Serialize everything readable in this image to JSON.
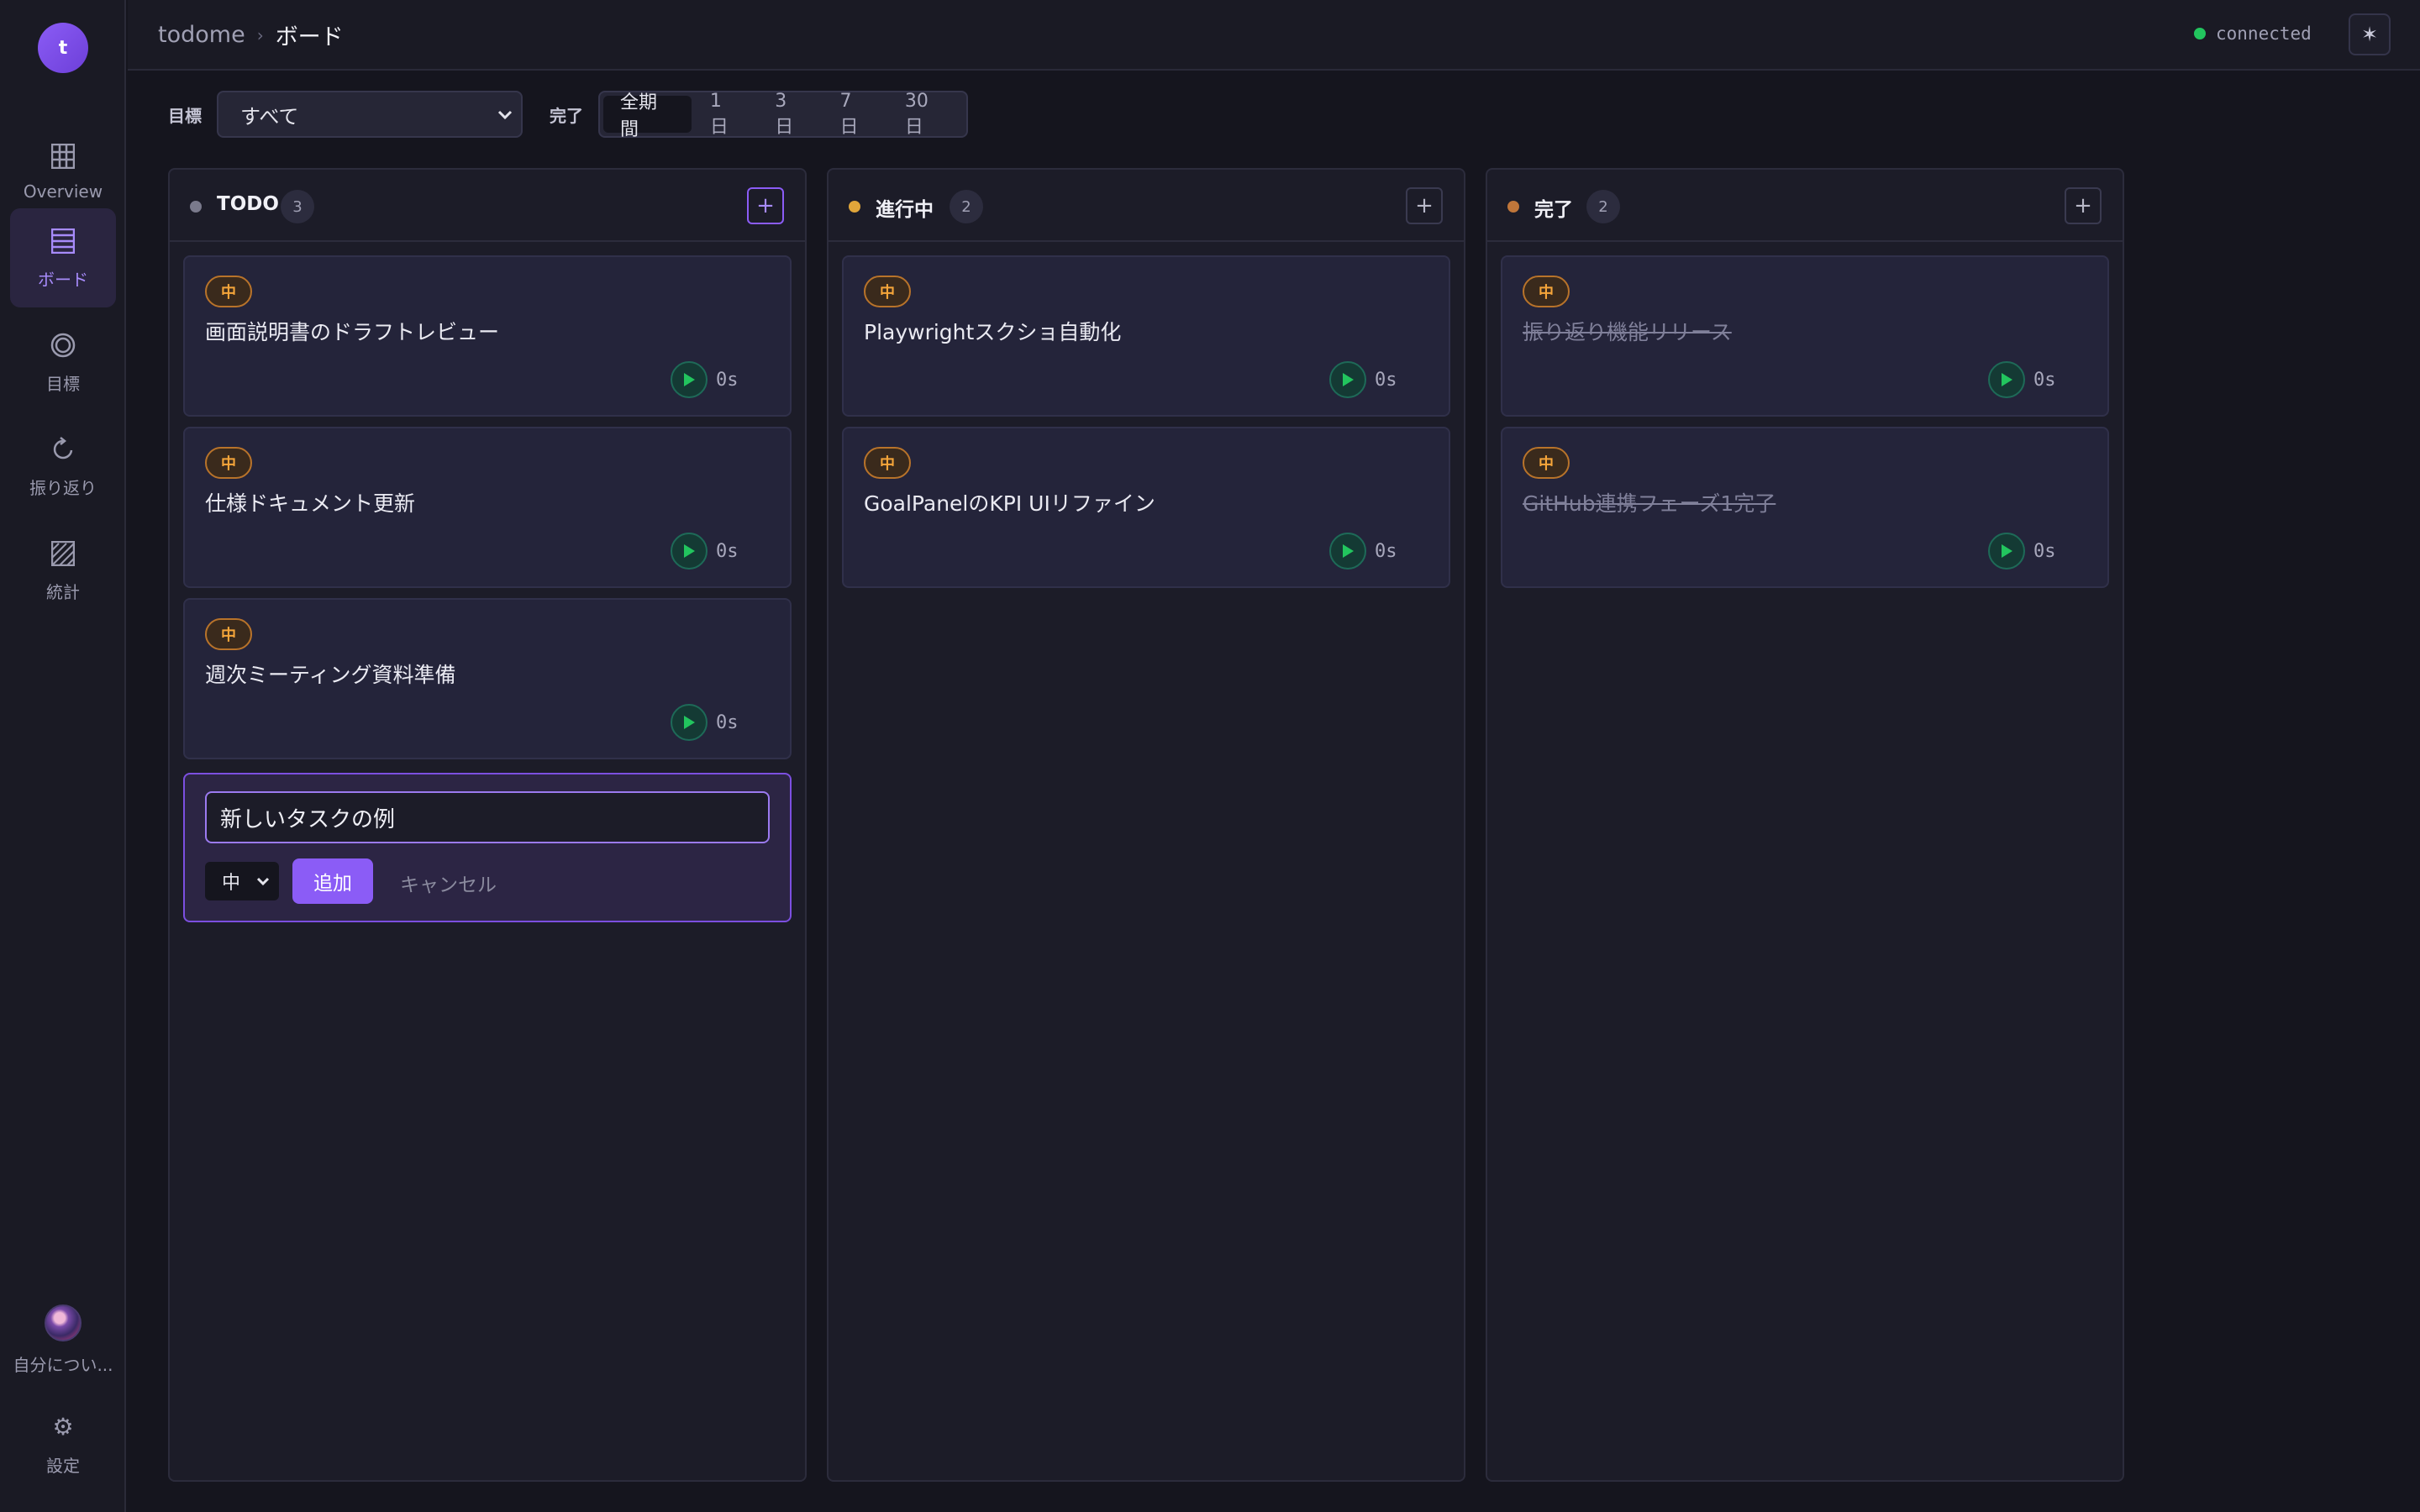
{
  "app": {
    "avatar_letter": "t",
    "accent": "#8b5cf6"
  },
  "header": {
    "breadcrumb_root": "todome",
    "breadcrumb_sep": "›",
    "breadcrumb_current": "ボード",
    "status_text": "connected",
    "status_color": "#22c55e",
    "theme_icon": "✶"
  },
  "sidebar": {
    "items": [
      {
        "label": "Overview",
        "icon": "grid-icon"
      },
      {
        "label": "ボード",
        "icon": "board-icon",
        "active": true
      },
      {
        "label": "目標",
        "icon": "target-icon"
      },
      {
        "label": "振り返り",
        "icon": "refresh-icon"
      },
      {
        "label": "統計",
        "icon": "stats-icon"
      }
    ],
    "profile_label": "自分につい...",
    "settings_label": "設定",
    "settings_icon": "⚙"
  },
  "filters": {
    "goal_label": "目標",
    "goal_value": "すべて",
    "done_label": "完了",
    "ranges": [
      "全期間",
      "1日",
      "3日",
      "7日",
      "30日"
    ],
    "active_range": "全期間"
  },
  "columns": [
    {
      "title": "TODO",
      "count": "3",
      "dot_color": "#7a7a8c",
      "cards": [
        {
          "priority": "中",
          "title": "画面説明書のドラフトレビュー",
          "time": "0s"
        },
        {
          "priority": "中",
          "title": "仕様ドキュメント更新",
          "time": "0s"
        },
        {
          "priority": "中",
          "title": "週次ミーティング資料準備",
          "time": "0s"
        }
      ]
    },
    {
      "title": "進行中",
      "count": "2",
      "dot_color": "#e0a53a",
      "cards": [
        {
          "priority": "中",
          "title": "Playwrightスクショ自動化",
          "time": "0s"
        },
        {
          "priority": "中",
          "title": "GoalPanelのKPI UIリファイン",
          "time": "0s"
        }
      ]
    },
    {
      "title": "完了",
      "count": "2",
      "dot_color": "#c0763a",
      "cards": [
        {
          "priority": "中",
          "title": "振り返り機能リリース",
          "time": "0s"
        },
        {
          "priority": "中",
          "title": "GitHub連携フェーズ1完了",
          "time": "0s"
        }
      ]
    }
  ],
  "new_task": {
    "value": "新しいタスクの例",
    "priority": "中",
    "add_label": "追加",
    "cancel_label": "キャンセル"
  },
  "add_symbol": "+"
}
